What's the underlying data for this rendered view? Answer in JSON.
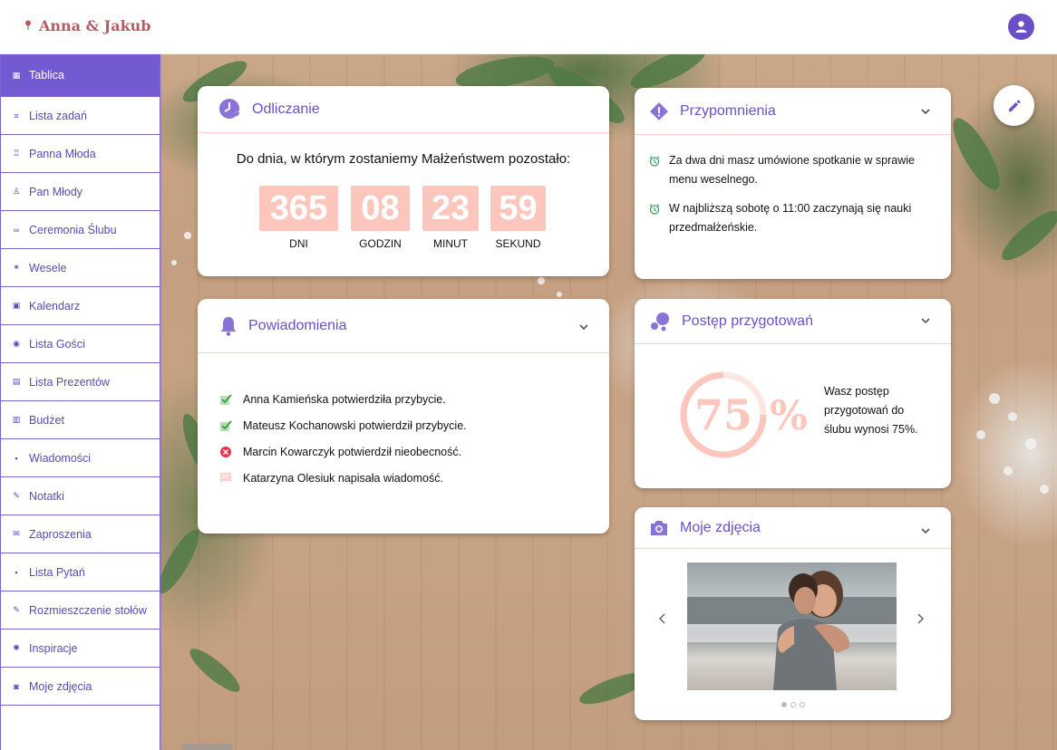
{
  "app": {
    "brand": "Anna & Jakub",
    "colors": {
      "accent": "#7359d2",
      "brand": "#b85a5f",
      "peach": "#fcc6bd"
    }
  },
  "sidebar": {
    "items": [
      {
        "label": "Tablica",
        "icon": "dashboard-icon",
        "active": true
      },
      {
        "label": "Lista zadań",
        "icon": "list-icon"
      },
      {
        "label": "Panna Młoda",
        "icon": "bride-icon"
      },
      {
        "label": "Pan Młody",
        "icon": "groom-icon"
      },
      {
        "label": "Ceremonia Ślubu",
        "icon": "rings-icon"
      },
      {
        "label": "Wesele",
        "icon": "party-icon"
      },
      {
        "label": "Kalendarz",
        "icon": "calendar-icon"
      },
      {
        "label": "Lista Gości",
        "icon": "guests-icon"
      },
      {
        "label": "Lista Prezentów",
        "icon": "gift-icon"
      },
      {
        "label": "Budżet",
        "icon": "budget-icon"
      },
      {
        "label": "Wiadomości",
        "icon": "message-icon"
      },
      {
        "label": "Notatki",
        "icon": "pencil-icon"
      },
      {
        "label": "Zaproszenia",
        "icon": "envelope-icon"
      },
      {
        "label": "Lista Pytań",
        "icon": "question-icon"
      },
      {
        "label": "Rozmieszczenie stołów",
        "icon": "table-icon"
      },
      {
        "label": "Inspiracje",
        "icon": "lightbulb-icon"
      },
      {
        "label": "Moje zdjęcia",
        "icon": "camera-icon"
      }
    ]
  },
  "countdown": {
    "title": "Odliczanie",
    "text": "Do dnia, w którym zostaniemy Małżeństwem pozostało:",
    "units": [
      {
        "value": "365",
        "label": "DNI"
      },
      {
        "value": "08",
        "label": "GODZIN"
      },
      {
        "value": "23",
        "label": "MINUT"
      },
      {
        "value": "59",
        "label": "SEKUND"
      }
    ]
  },
  "reminders": {
    "title": "Przypomnienia",
    "items": [
      "Za dwa dni masz umówione spotkanie w sprawie menu weselnego.",
      "W najbliższą sobotę o 11:00 zaczynają się nauki przedmałżeńskie."
    ]
  },
  "notifications": {
    "title": "Powiadomienia",
    "items": [
      {
        "text": "Anna Kamieńska potwierdziła przybycie.",
        "type": "confirmed"
      },
      {
        "text": "Mateusz Kochanowski potwierdził przybycie.",
        "type": "confirmed"
      },
      {
        "text": "Marcin Kowarczyk potwierdził nieobecność.",
        "type": "declined"
      },
      {
        "text": "Katarzyna Olesiuk napisała wiadomość.",
        "type": "message"
      }
    ]
  },
  "progress": {
    "title": "Postęp przygotowań",
    "value": 75,
    "value_text": "75",
    "percent_sign": "%",
    "description": "Wasz postęp przygotowań do ślubu wynosi 75%."
  },
  "photos": {
    "title": "Moje zdjęcia",
    "current_index": 0,
    "count": 3
  }
}
